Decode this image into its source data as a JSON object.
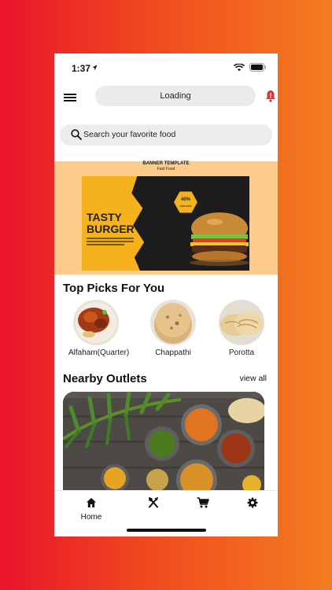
{
  "status": {
    "time": "1:37"
  },
  "appbar": {
    "title": "Loading"
  },
  "search": {
    "placeholder": "Search your favorite food"
  },
  "banner": {
    "template_label": "BANNER TEMPLATE",
    "subtitle": "Fast Food",
    "headline_line1": "TASTY",
    "headline_line2": "BURGER",
    "discount_percent": "40%",
    "discount_label": "discount",
    "carousel_active_index": 0,
    "carousel_count": 3
  },
  "top_picks": {
    "title": "Top Picks For You",
    "items": [
      {
        "name": "Alfaham(Quarter)"
      },
      {
        "name": "Chappathi"
      },
      {
        "name": "Porotta"
      }
    ]
  },
  "nearby": {
    "title": "Nearby Outlets",
    "view_all": "view all"
  },
  "bottom_nav": {
    "items": [
      {
        "label": "Home",
        "icon": "home-icon",
        "active": true
      },
      {
        "label": "",
        "icon": "fork-knife-icon"
      },
      {
        "label": "",
        "icon": "cart-icon"
      },
      {
        "label": "",
        "icon": "settings-gear-icon"
      }
    ]
  },
  "colors": {
    "background_gradient_start": "#e9142a",
    "background_gradient_end": "#f37d1f",
    "banner_bg": "#fdcb8a",
    "carousel_active": "#e8305a",
    "accent_yellow": "#f5b21c"
  }
}
